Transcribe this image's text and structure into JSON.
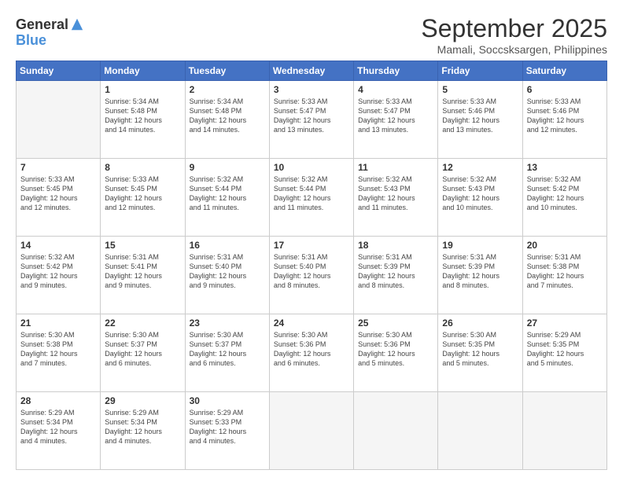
{
  "header": {
    "logo_line1": "General",
    "logo_line2": "Blue",
    "month": "September 2025",
    "location": "Mamali, Soccsksargen, Philippines"
  },
  "weekdays": [
    "Sunday",
    "Monday",
    "Tuesday",
    "Wednesday",
    "Thursday",
    "Friday",
    "Saturday"
  ],
  "weeks": [
    [
      {
        "day": "",
        "info": ""
      },
      {
        "day": "1",
        "info": "Sunrise: 5:34 AM\nSunset: 5:48 PM\nDaylight: 12 hours\nand 14 minutes."
      },
      {
        "day": "2",
        "info": "Sunrise: 5:34 AM\nSunset: 5:48 PM\nDaylight: 12 hours\nand 14 minutes."
      },
      {
        "day": "3",
        "info": "Sunrise: 5:33 AM\nSunset: 5:47 PM\nDaylight: 12 hours\nand 13 minutes."
      },
      {
        "day": "4",
        "info": "Sunrise: 5:33 AM\nSunset: 5:47 PM\nDaylight: 12 hours\nand 13 minutes."
      },
      {
        "day": "5",
        "info": "Sunrise: 5:33 AM\nSunset: 5:46 PM\nDaylight: 12 hours\nand 13 minutes."
      },
      {
        "day": "6",
        "info": "Sunrise: 5:33 AM\nSunset: 5:46 PM\nDaylight: 12 hours\nand 12 minutes."
      }
    ],
    [
      {
        "day": "7",
        "info": "Sunrise: 5:33 AM\nSunset: 5:45 PM\nDaylight: 12 hours\nand 12 minutes."
      },
      {
        "day": "8",
        "info": "Sunrise: 5:33 AM\nSunset: 5:45 PM\nDaylight: 12 hours\nand 12 minutes."
      },
      {
        "day": "9",
        "info": "Sunrise: 5:32 AM\nSunset: 5:44 PM\nDaylight: 12 hours\nand 11 minutes."
      },
      {
        "day": "10",
        "info": "Sunrise: 5:32 AM\nSunset: 5:44 PM\nDaylight: 12 hours\nand 11 minutes."
      },
      {
        "day": "11",
        "info": "Sunrise: 5:32 AM\nSunset: 5:43 PM\nDaylight: 12 hours\nand 11 minutes."
      },
      {
        "day": "12",
        "info": "Sunrise: 5:32 AM\nSunset: 5:43 PM\nDaylight: 12 hours\nand 10 minutes."
      },
      {
        "day": "13",
        "info": "Sunrise: 5:32 AM\nSunset: 5:42 PM\nDaylight: 12 hours\nand 10 minutes."
      }
    ],
    [
      {
        "day": "14",
        "info": "Sunrise: 5:32 AM\nSunset: 5:42 PM\nDaylight: 12 hours\nand 9 minutes."
      },
      {
        "day": "15",
        "info": "Sunrise: 5:31 AM\nSunset: 5:41 PM\nDaylight: 12 hours\nand 9 minutes."
      },
      {
        "day": "16",
        "info": "Sunrise: 5:31 AM\nSunset: 5:40 PM\nDaylight: 12 hours\nand 9 minutes."
      },
      {
        "day": "17",
        "info": "Sunrise: 5:31 AM\nSunset: 5:40 PM\nDaylight: 12 hours\nand 8 minutes."
      },
      {
        "day": "18",
        "info": "Sunrise: 5:31 AM\nSunset: 5:39 PM\nDaylight: 12 hours\nand 8 minutes."
      },
      {
        "day": "19",
        "info": "Sunrise: 5:31 AM\nSunset: 5:39 PM\nDaylight: 12 hours\nand 8 minutes."
      },
      {
        "day": "20",
        "info": "Sunrise: 5:31 AM\nSunset: 5:38 PM\nDaylight: 12 hours\nand 7 minutes."
      }
    ],
    [
      {
        "day": "21",
        "info": "Sunrise: 5:30 AM\nSunset: 5:38 PM\nDaylight: 12 hours\nand 7 minutes."
      },
      {
        "day": "22",
        "info": "Sunrise: 5:30 AM\nSunset: 5:37 PM\nDaylight: 12 hours\nand 6 minutes."
      },
      {
        "day": "23",
        "info": "Sunrise: 5:30 AM\nSunset: 5:37 PM\nDaylight: 12 hours\nand 6 minutes."
      },
      {
        "day": "24",
        "info": "Sunrise: 5:30 AM\nSunset: 5:36 PM\nDaylight: 12 hours\nand 6 minutes."
      },
      {
        "day": "25",
        "info": "Sunrise: 5:30 AM\nSunset: 5:36 PM\nDaylight: 12 hours\nand 5 minutes."
      },
      {
        "day": "26",
        "info": "Sunrise: 5:30 AM\nSunset: 5:35 PM\nDaylight: 12 hours\nand 5 minutes."
      },
      {
        "day": "27",
        "info": "Sunrise: 5:29 AM\nSunset: 5:35 PM\nDaylight: 12 hours\nand 5 minutes."
      }
    ],
    [
      {
        "day": "28",
        "info": "Sunrise: 5:29 AM\nSunset: 5:34 PM\nDaylight: 12 hours\nand 4 minutes."
      },
      {
        "day": "29",
        "info": "Sunrise: 5:29 AM\nSunset: 5:34 PM\nDaylight: 12 hours\nand 4 minutes."
      },
      {
        "day": "30",
        "info": "Sunrise: 5:29 AM\nSunset: 5:33 PM\nDaylight: 12 hours\nand 4 minutes."
      },
      {
        "day": "",
        "info": ""
      },
      {
        "day": "",
        "info": ""
      },
      {
        "day": "",
        "info": ""
      },
      {
        "day": "",
        "info": ""
      }
    ]
  ]
}
